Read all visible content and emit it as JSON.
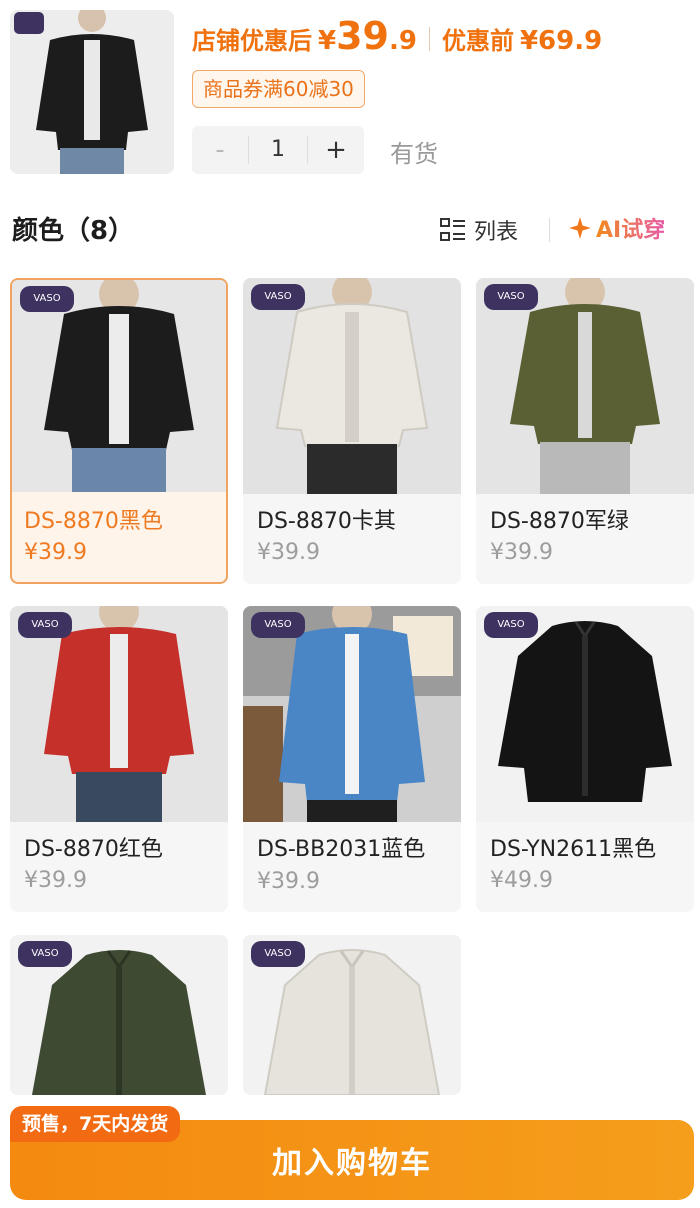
{
  "header": {
    "after_discount_label": "店铺优惠后",
    "currency": "¥",
    "price_int": "39",
    "price_dec": ".9",
    "before_discount_label": "优惠前",
    "before_price": "¥69.9",
    "coupon": "商品券满60减30",
    "qty_minus": "-",
    "qty_value": "1",
    "qty_plus": "+",
    "stock": "有货"
  },
  "colors": {
    "title": "颜色（8）",
    "list_toggle": "列表",
    "ai_try": "AI试穿",
    "brand_tag": "VASO"
  },
  "variants": [
    {
      "name": "DS-8870黑色",
      "price": "¥39.9",
      "selected": true
    },
    {
      "name": "DS-8870卡其",
      "price": "¥39.9"
    },
    {
      "name": "DS-8870军绿",
      "price": "¥39.9"
    },
    {
      "name": "DS-8870红色",
      "price": "¥39.9"
    },
    {
      "name": "DS-BB2031蓝色",
      "price": "¥39.9"
    },
    {
      "name": "DS-YN2611黑色",
      "price": "¥49.9"
    },
    {
      "name": "",
      "price": ""
    },
    {
      "name": "",
      "price": ""
    }
  ],
  "bottom": {
    "presale": "预售，7天内发货",
    "add_to_cart": "加入购物车"
  },
  "palette": {
    "accent": "#f0720f",
    "cart": "#f48a10",
    "jacket_black": "#1c1c1c",
    "jacket_khaki": "#ebe8e1",
    "jacket_olive": "#5b5f34",
    "jacket_red": "#c6302a",
    "jacket_blue": "#4a86c6",
    "jacket_green": "#3f4a33"
  }
}
